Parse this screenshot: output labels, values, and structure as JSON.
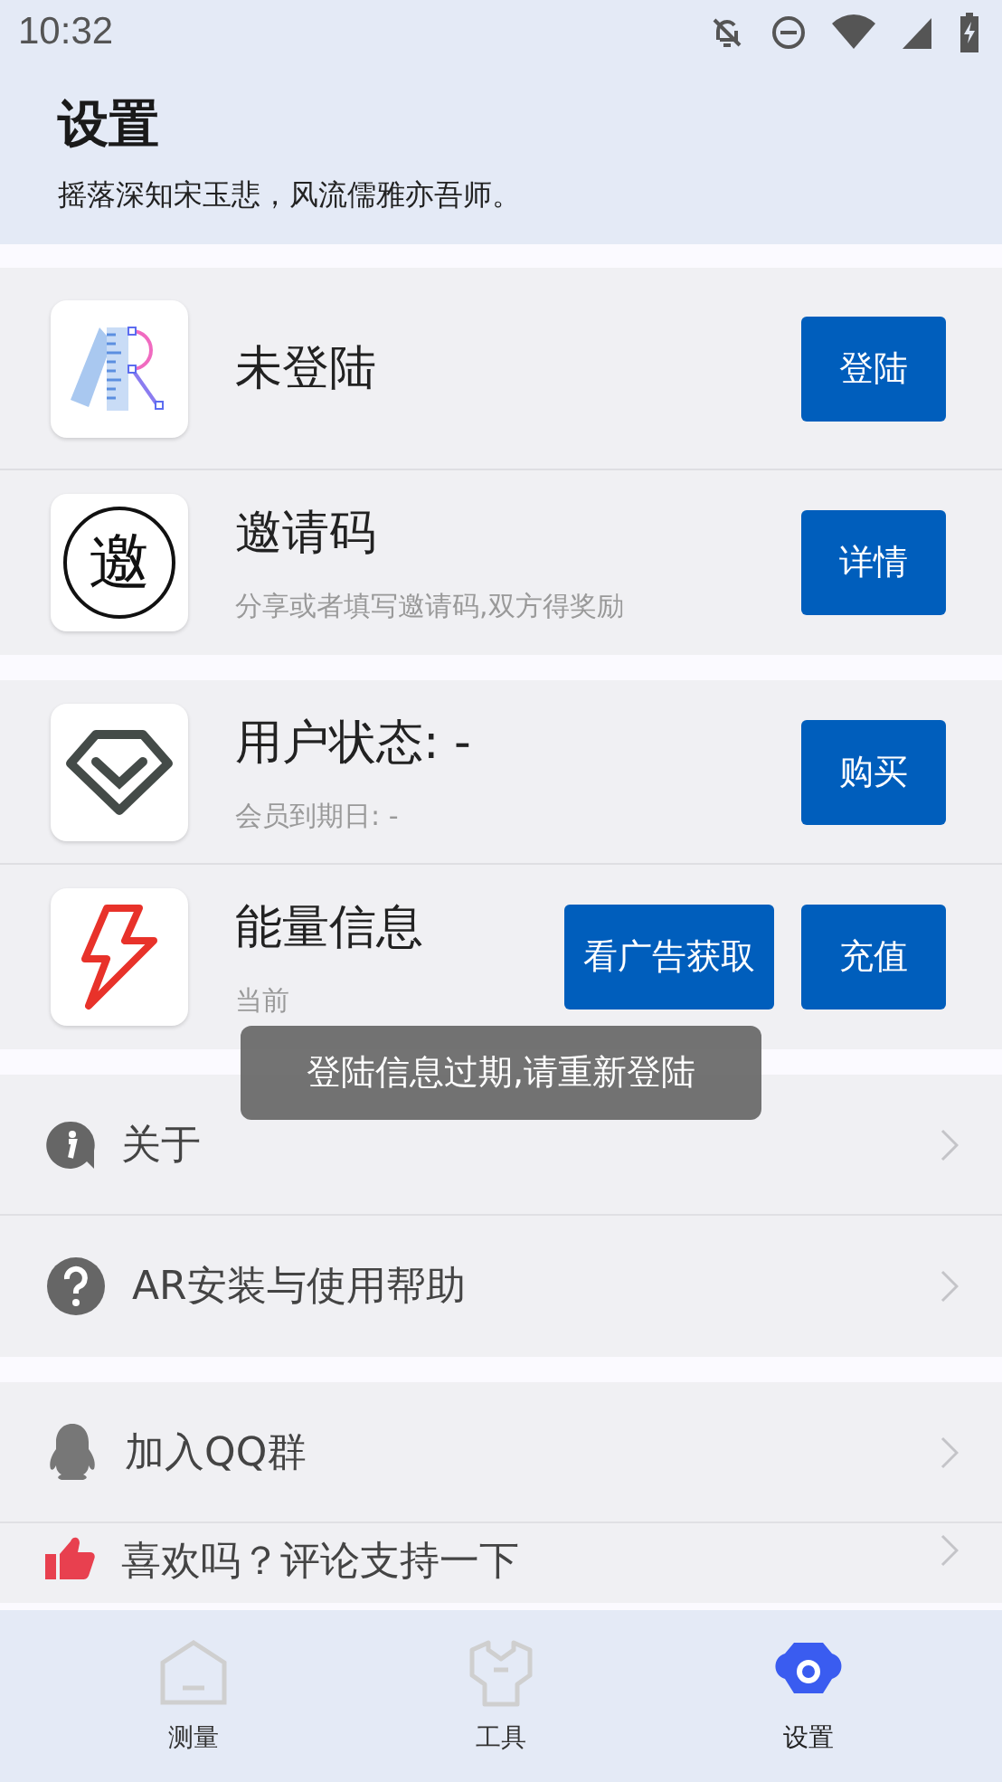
{
  "status_bar": {
    "time": "10:32"
  },
  "header": {
    "title": "设置",
    "subtitle": "摇落深知宋玉悲，风流儒雅亦吾师。"
  },
  "account_groups": [
    [
      {
        "kind": "logo",
        "title": "未登陆",
        "buttons": [
          "登陆"
        ]
      },
      {
        "kind": "invite",
        "icon_text": "邀",
        "title": "邀请码",
        "subtitle": "分享或者填写邀请码,双方得奖励",
        "buttons": [
          "详情"
        ]
      }
    ],
    [
      {
        "kind": "diamond",
        "title": "用户状态: -",
        "subtitle": "会员到期日: -",
        "buttons": [
          "购买"
        ]
      },
      {
        "kind": "bolt",
        "title": "能量信息",
        "subtitle": "当前",
        "buttons": [
          "看广告获取",
          "充值"
        ]
      }
    ]
  ],
  "menu_groups": [
    [
      {
        "kind": "info",
        "label": "关于"
      },
      {
        "kind": "help",
        "label": "AR安装与使用帮助"
      }
    ],
    [
      {
        "kind": "penguin",
        "label": "加入QQ群"
      },
      {
        "kind": "thumb",
        "label": "喜欢吗？评论支持一下"
      }
    ]
  ],
  "toast": {
    "text": "登陆信息过期,请重新登陆"
  },
  "bottom_nav": [
    {
      "kind": "home",
      "label": "测量",
      "selected": false
    },
    {
      "kind": "tool",
      "label": "工具",
      "selected": false
    },
    {
      "kind": "gear",
      "label": "设置",
      "selected": true
    }
  ]
}
